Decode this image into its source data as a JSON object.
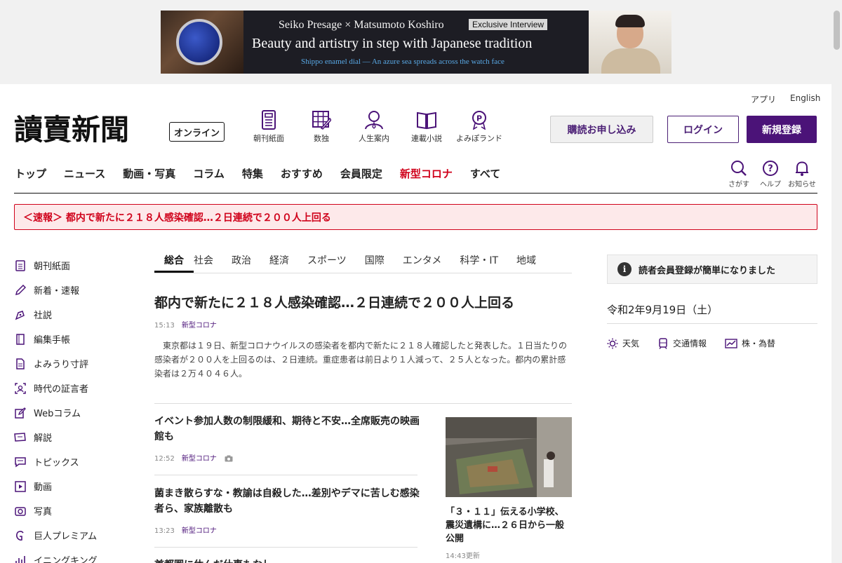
{
  "ad": {
    "line1": "Seiko Presage × Matsumoto Koshiro",
    "badge": "Exclusive Interview",
    "line2": "Beauty and artistry  in step with Japanese tradition",
    "line3": "Shippo enamel dial — An azure sea spreads across the watch face"
  },
  "header": {
    "util": [
      "アプリ",
      "English"
    ],
    "logo": "讀賣新聞",
    "online_badge": "オンライン",
    "icons": [
      {
        "label": "朝刊紙面",
        "icon": "newspaper-icon"
      },
      {
        "label": "数独",
        "icon": "sudoku-icon"
      },
      {
        "label": "人生案内",
        "icon": "person-icon"
      },
      {
        "label": "連載小説",
        "icon": "book-icon"
      },
      {
        "label": "よみぽランド",
        "icon": "points-icon"
      }
    ],
    "subscribe": "購読お申し込み",
    "login": "ログイン",
    "register": "新規登録"
  },
  "nav": {
    "items": [
      "トップ",
      "ニュース",
      "動画・写真",
      "コラム",
      "特集",
      "おすすめ",
      "会員限定",
      "新型コロナ",
      "すべて"
    ],
    "tools": [
      {
        "label": "さがす",
        "icon": "search-icon"
      },
      {
        "label": "ヘルプ",
        "icon": "help-icon"
      },
      {
        "label": "お知らせ",
        "icon": "bell-icon"
      }
    ]
  },
  "breaking": "＜速報＞ 都内で新たに２１８人感染確認…２日連続で２００人上回る",
  "sidebar": {
    "items": [
      {
        "label": "朝刊紙面",
        "icon": "newspaper-icon"
      },
      {
        "label": "新着・速報",
        "icon": "pencil-icon"
      },
      {
        "label": "社説",
        "icon": "pen-nib-icon"
      },
      {
        "label": "編集手帳",
        "icon": "notebook-icon"
      },
      {
        "label": "よみうり寸評",
        "icon": "document-icon"
      },
      {
        "label": "時代の証言者",
        "icon": "portrait-icon"
      },
      {
        "label": "Webコラム",
        "icon": "edit-icon"
      },
      {
        "label": "解説",
        "icon": "screen-icon"
      },
      {
        "label": "トピックス",
        "icon": "chat-icon"
      },
      {
        "label": "動画",
        "icon": "play-icon"
      },
      {
        "label": "写真",
        "icon": "camera-icon"
      },
      {
        "label": "巨人プレミアム",
        "icon": "giants-icon"
      },
      {
        "label": "イニングキング",
        "icon": "chart-icon"
      }
    ]
  },
  "tabs": [
    "総合",
    "社会",
    "政治",
    "経済",
    "スポーツ",
    "国際",
    "エンタメ",
    "科学・IT",
    "地域"
  ],
  "top_story": {
    "headline": "都内で新たに２１８人感染確認…２日連続で２００人上回る",
    "time": "15:13",
    "category": "新型コロナ",
    "lead": "　東京都は１９日、新型コロナウイルスの感染者を都内で新たに２１８人確認したと発表した。１日当たりの感染者が２００人を上回るのは、２日連続。重症患者は前日より１人減って、２５人となった。都内の累計感染者は２万４０４６人。"
  },
  "articles": [
    {
      "title": "イベント参加人数の制限緩和、期待と不安…全席販売の映画館も",
      "time": "12:52",
      "category": "新型コロナ",
      "has_photo": true
    },
    {
      "title": "菌まき散らすな・教諭は自殺した…差別やデマに苦しむ感染者ら、家族離散も",
      "time": "13:23",
      "category": "新型コロナ",
      "has_photo": false
    },
    {
      "title": "首都圏に休んだ仕事もなし…",
      "time": "",
      "category": "",
      "has_photo": false
    }
  ],
  "photo_story": {
    "caption": "「３・１１」伝える小学校、震災遺構に…２６日から一般公開",
    "time": "14:43更新"
  },
  "right": {
    "notice": "読者会員登録が簡単になりました",
    "date": "令和2年9月19日（土）",
    "quick": [
      {
        "label": "天気",
        "icon": "sun-icon"
      },
      {
        "label": "交通情報",
        "icon": "train-icon"
      },
      {
        "label": "株・為替",
        "icon": "stock-chart-icon"
      }
    ]
  },
  "colors": {
    "brand": "#4b1378",
    "alert": "#d0021b",
    "alert_bg": "#fde9ea"
  }
}
